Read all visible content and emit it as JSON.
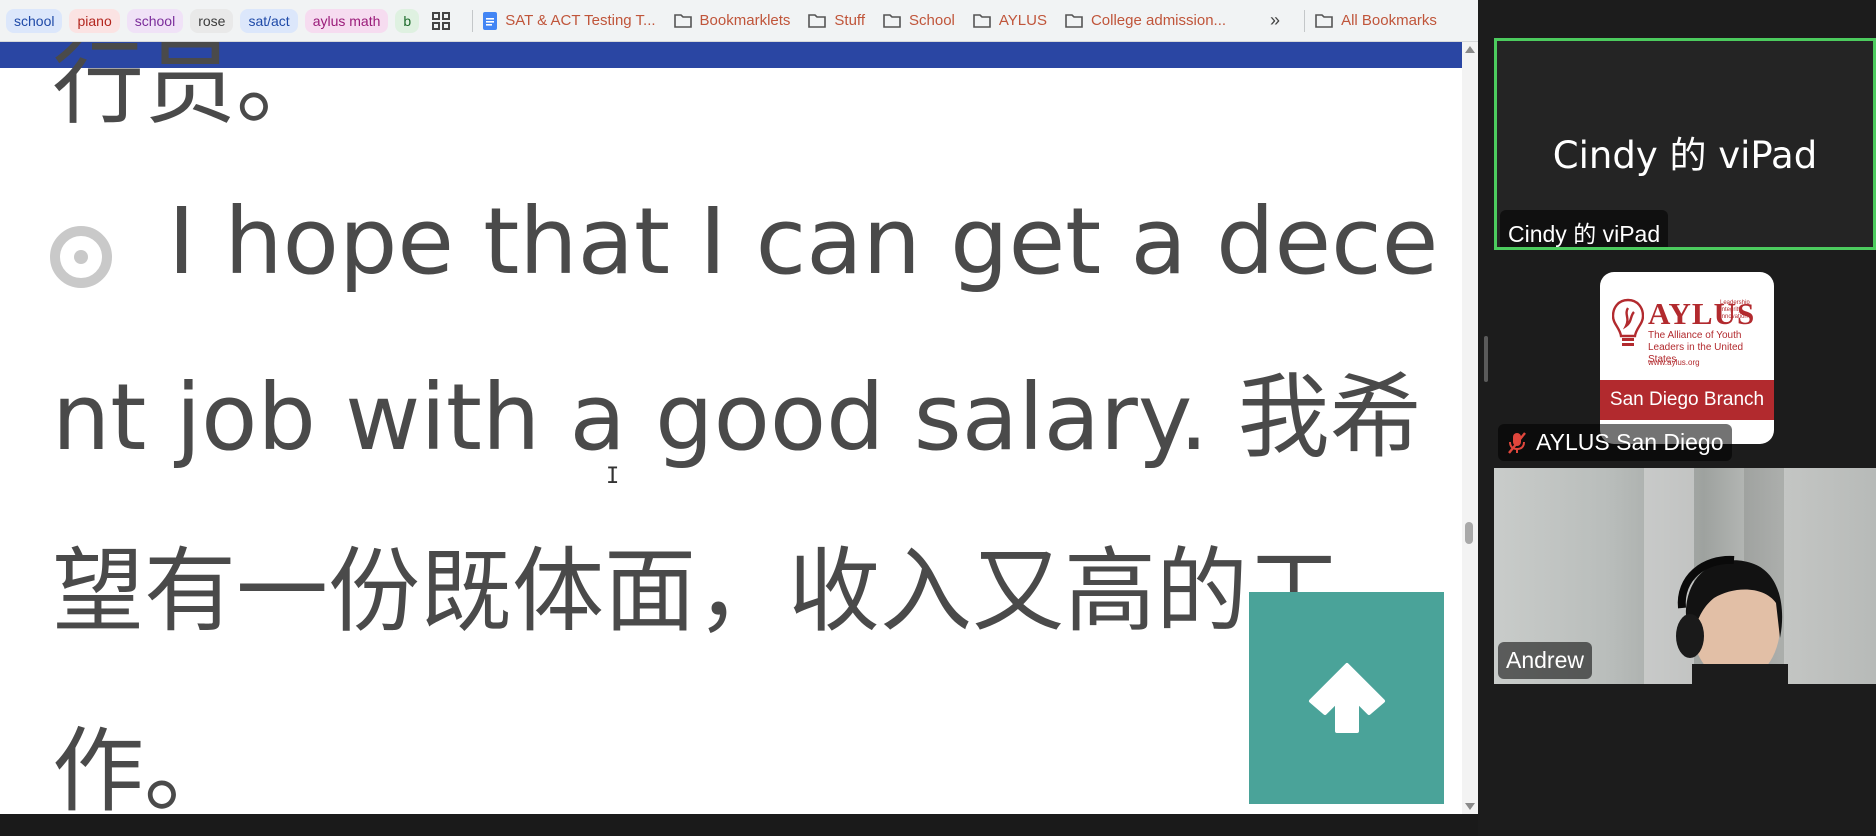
{
  "bookmarks": {
    "chips": [
      {
        "label": "school"
      },
      {
        "label": "piano"
      },
      {
        "label": "school"
      },
      {
        "label": "rose"
      },
      {
        "label": "sat/act"
      },
      {
        "label": "aylus math"
      },
      {
        "label": "b"
      }
    ],
    "items": [
      {
        "label": "SAT & ACT Testing T...",
        "icon": "google-docs-icon"
      },
      {
        "label": "Bookmarklets",
        "icon": "folder-icon"
      },
      {
        "label": "Stuff",
        "icon": "folder-icon"
      },
      {
        "label": "School",
        "icon": "folder-icon"
      },
      {
        "label": "AYLUS",
        "icon": "folder-icon"
      },
      {
        "label": "College admission...",
        "icon": "folder-icon"
      }
    ],
    "more": "»",
    "all_bookmarks": "All Bookmarks"
  },
  "content": {
    "line0": "行员。",
    "line1": "I hope that I can get a dece",
    "line2": "nt job with a good salary. 我希",
    "line3": "望有一份既体面，收入又高的工",
    "line4": "作。"
  },
  "participants": {
    "cindy": {
      "display": "Cindy 的 viPad",
      "name": "Cindy 的 viPad"
    },
    "aylus": {
      "name": "AYLUS San Diego",
      "logo_brand": "AYLUS",
      "logo_tagline": "Leadership Integrity Innovation",
      "logo_full": "The Alliance of Youth Leaders in the United States",
      "logo_url": "www.aylus.org",
      "logo_branch": "San Diego Branch"
    },
    "andrew": {
      "name": "Andrew"
    }
  },
  "colors": {
    "accent_speaker": "#4ccb5e",
    "scroll_top_button": "#4aa399",
    "aylus_red": "#b22a2e",
    "page_header_band": "#2a46a3"
  }
}
